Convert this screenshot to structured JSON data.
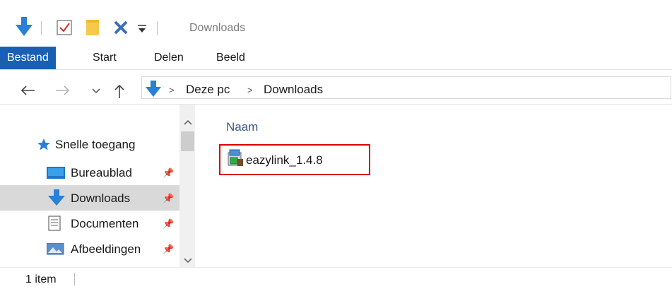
{
  "window": {
    "title": "Downloads"
  },
  "colors": {
    "accent": "#1a5fb4",
    "selection": "#d9d9d9",
    "highlight": "#d80000",
    "folder_yellow": "#f6c94d",
    "download_blue": "#2a7fd6"
  },
  "quick_access_toolbar": {
    "icons": [
      "download-icon",
      "properties-checkbox-icon",
      "new-folder-icon",
      "delete-x-icon",
      "customize-dropdown-icon"
    ]
  },
  "ribbon": {
    "tabs": [
      {
        "label": "Bestand",
        "active": true
      },
      {
        "label": "Start"
      },
      {
        "label": "Delen"
      },
      {
        "label": "Beeld"
      }
    ]
  },
  "navigation": {
    "back_icon": "back-arrow-icon",
    "forward_icon": "forward-arrow-icon",
    "recent_icon": "chevron-down-icon",
    "up_icon": "up-arrow-icon"
  },
  "address": {
    "breadcrumb": [
      "Deze pc",
      "Downloads"
    ]
  },
  "nav_pane": {
    "quick_access": "Snelle toegang",
    "items": [
      {
        "label": "Bureaublad",
        "icon": "desktop-icon",
        "pinned": true
      },
      {
        "label": "Downloads",
        "icon": "downloads-icon",
        "pinned": true,
        "selected": true
      },
      {
        "label": "Documenten",
        "icon": "documents-icon",
        "pinned": true
      },
      {
        "label": "Afbeeldingen",
        "icon": "pictures-icon",
        "pinned": true
      }
    ]
  },
  "content": {
    "column_header": "Naam",
    "files": [
      {
        "name": "eazylink_1.4.8",
        "icon": "installer-icon"
      }
    ]
  },
  "status": {
    "item_count": "1 item"
  }
}
